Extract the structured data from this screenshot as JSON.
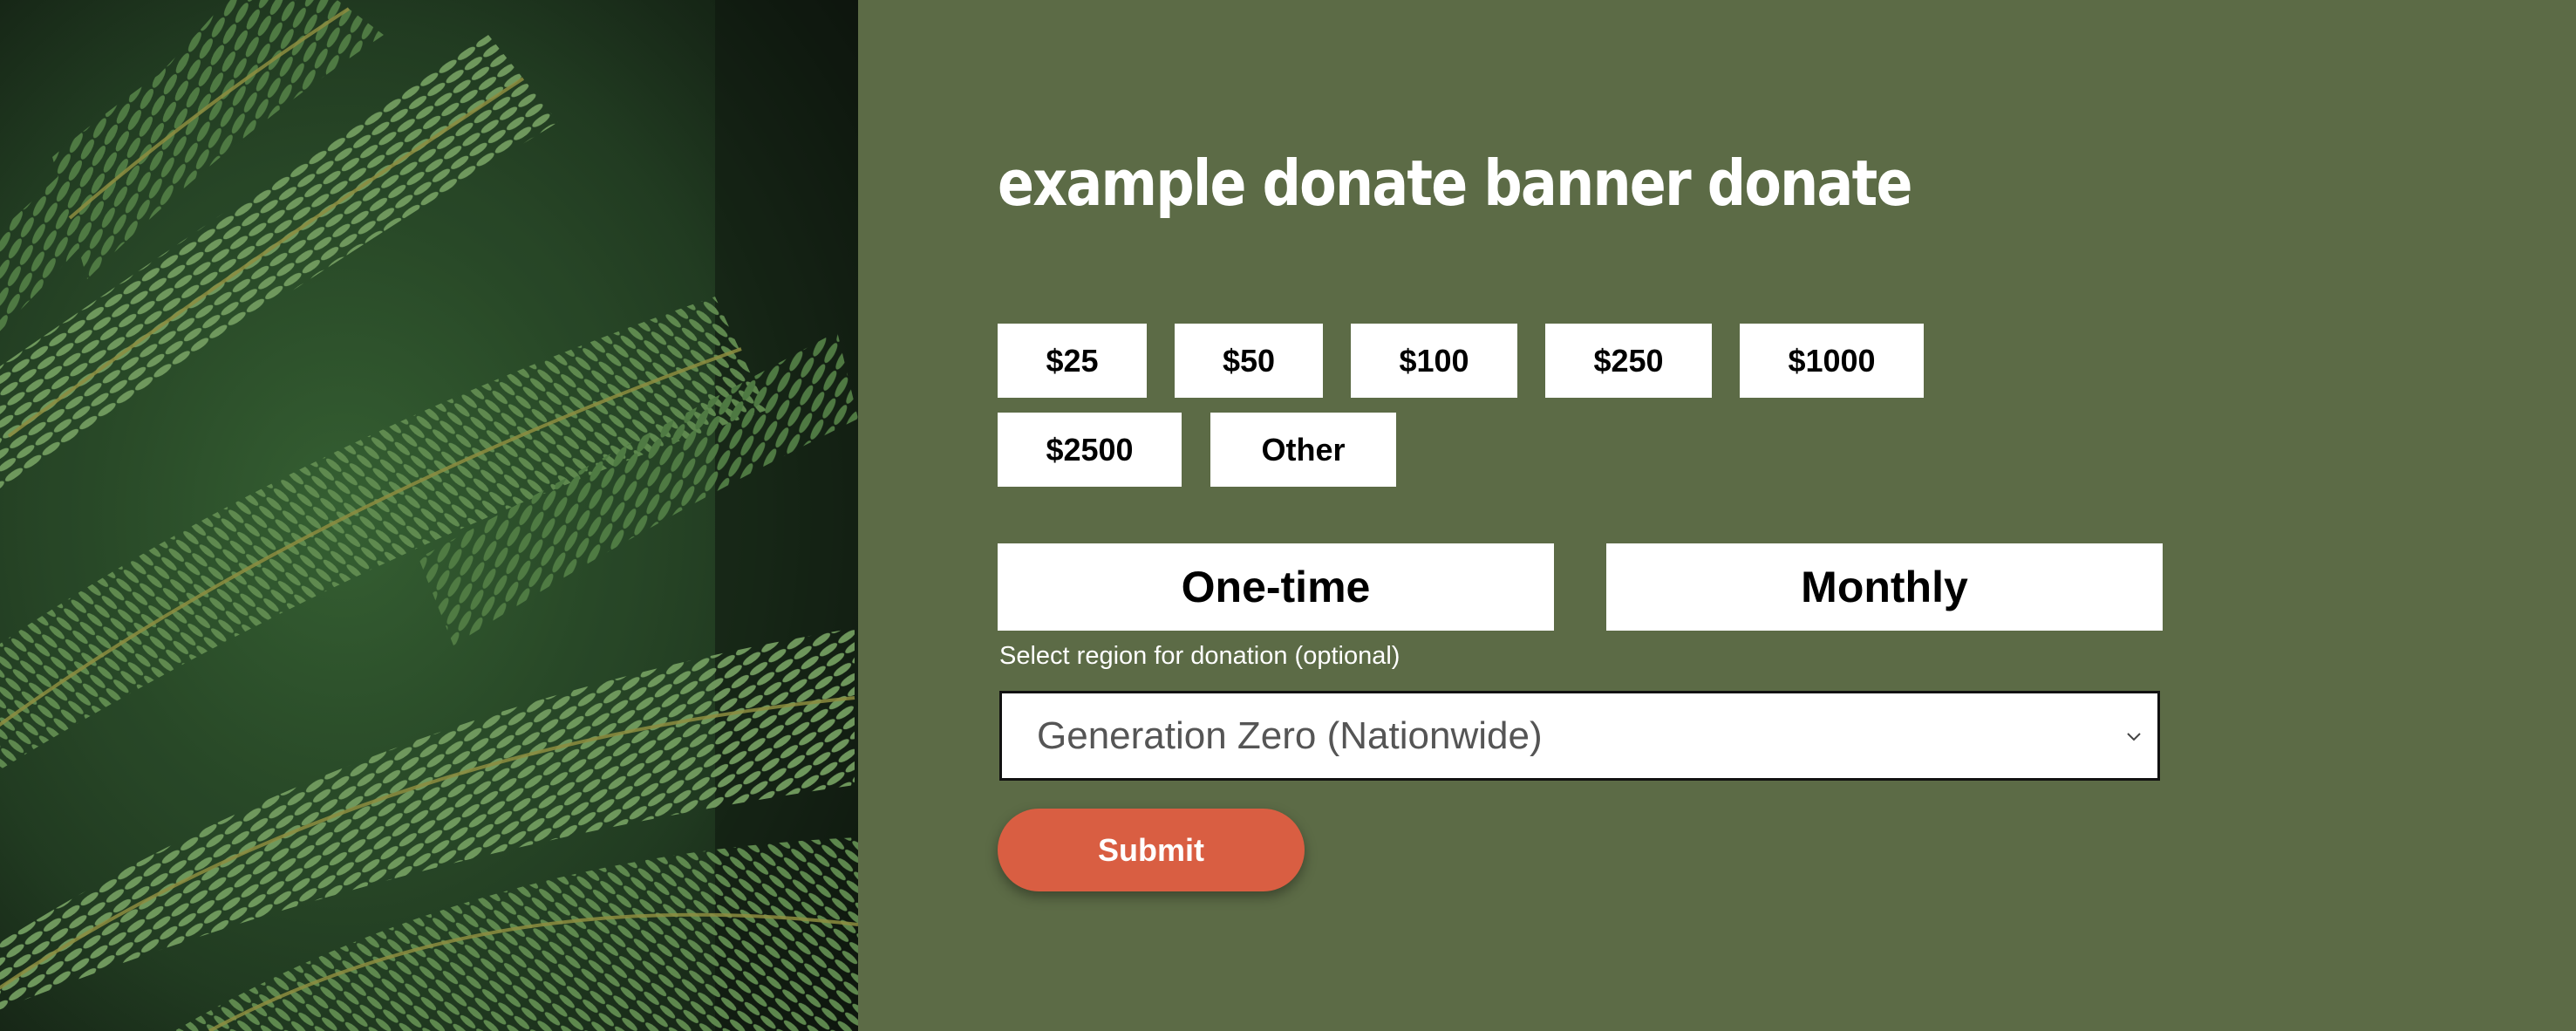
{
  "banner": {
    "title": "example donate banner donate",
    "image_alt": "fern-fronds-photo"
  },
  "amounts": [
    {
      "label": "$25"
    },
    {
      "label": "$50"
    },
    {
      "label": "$100"
    },
    {
      "label": "$250"
    },
    {
      "label": "$1000"
    },
    {
      "label": "$2500"
    },
    {
      "label": "Other"
    }
  ],
  "frequency": {
    "one_time": "One-time",
    "monthly": "Monthly"
  },
  "region": {
    "label": "Select region for donation (optional)",
    "selected": "Generation Zero (Nationwide)",
    "icon": "chevron-down-icon"
  },
  "submit": {
    "label": "Submit"
  },
  "colors": {
    "panel_background": "#5c6b46",
    "button_background": "#ffffff",
    "submit_background": "#d95e42",
    "text_light": "#ffffff"
  }
}
